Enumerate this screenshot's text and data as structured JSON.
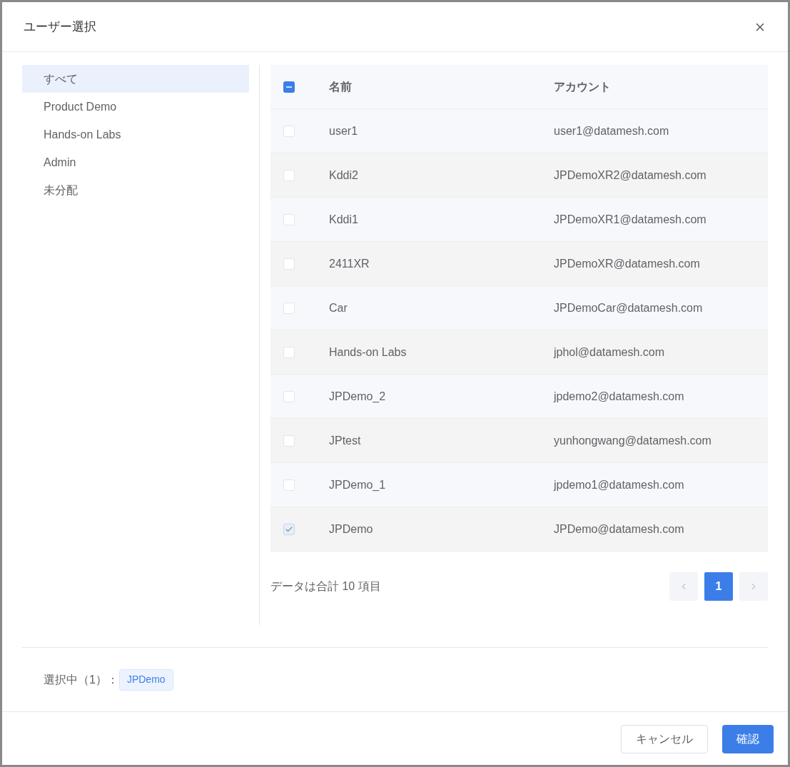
{
  "dialog": {
    "title": "ユーザー選択"
  },
  "groups": [
    {
      "label": "すべて",
      "selected": true
    },
    {
      "label": "Product Demo",
      "selected": false
    },
    {
      "label": "Hands-on Labs",
      "selected": false
    },
    {
      "label": "Admin",
      "selected": false
    },
    {
      "label": "未分配",
      "selected": false
    }
  ],
  "table": {
    "select_all": {
      "indeterminate": true
    },
    "columns": [
      "名前",
      "アカウント"
    ],
    "rows": [
      {
        "name": "user1",
        "account": "user1@datamesh.com",
        "checked": false
      },
      {
        "name": "Kddi2",
        "account": "JPDemoXR2@datamesh.com",
        "checked": false
      },
      {
        "name": "Kddi1",
        "account": "JPDemoXR1@datamesh.com",
        "checked": false
      },
      {
        "name": "2411XR",
        "account": "JPDemoXR@datamesh.com",
        "checked": false
      },
      {
        "name": "Car",
        "account": "JPDemoCar@datamesh.com",
        "checked": false
      },
      {
        "name": "Hands-on Labs",
        "account": "jphol@datamesh.com",
        "checked": false
      },
      {
        "name": "JPDemo_2",
        "account": "jpdemo2@datamesh.com",
        "checked": false
      },
      {
        "name": "JPtest",
        "account": "yunhongwang@datamesh.com",
        "checked": false
      },
      {
        "name": "JPDemo_1",
        "account": "jpdemo1@datamesh.com",
        "checked": false
      },
      {
        "name": "JPDemo",
        "account": "JPDemo@datamesh.com",
        "checked": true
      }
    ]
  },
  "pagination": {
    "total": "データは合計 10 項目",
    "pages": [
      {
        "label": "1",
        "selected": true
      }
    ]
  },
  "selection": {
    "label": "選択中（1）：",
    "tags": [
      "JPDemo"
    ]
  },
  "buttons": {
    "cancel": "キャンセル",
    "confirm": "確認"
  }
}
